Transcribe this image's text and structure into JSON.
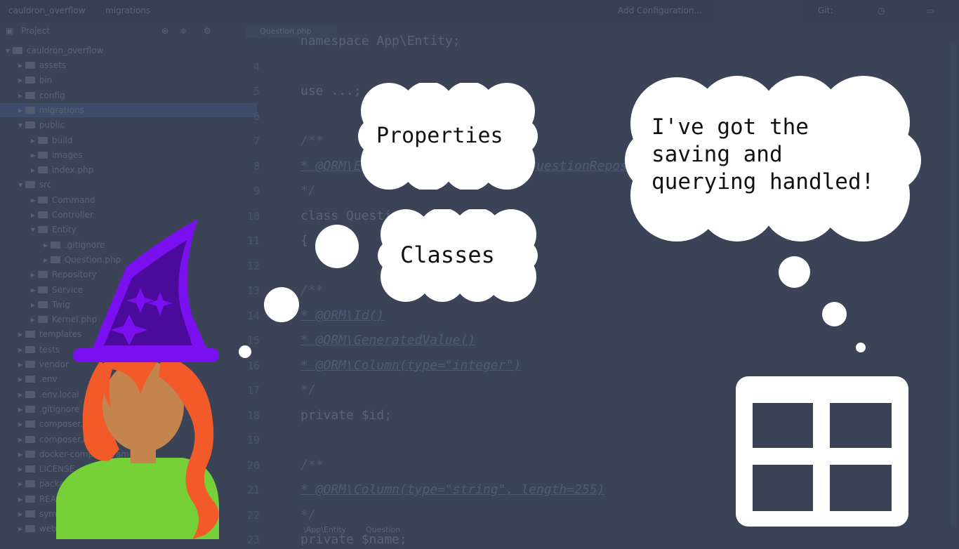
{
  "ide": {
    "window_title": "cauldron_overflow",
    "breadcrumb": "migrations",
    "run_config": "Add Configuration...",
    "git_label": "Git:",
    "project_panel": {
      "title": "Project",
      "root": "cauldron_overflow"
    },
    "tree": [
      {
        "label": "assets",
        "depth": 1,
        "expanded": false,
        "selected": false
      },
      {
        "label": "bin",
        "depth": 1,
        "expanded": false,
        "selected": false
      },
      {
        "label": "config",
        "depth": 1,
        "expanded": false,
        "selected": false
      },
      {
        "label": "migrations",
        "depth": 1,
        "expanded": false,
        "selected": true
      },
      {
        "label": "public",
        "depth": 1,
        "expanded": true,
        "selected": false
      },
      {
        "label": "build",
        "depth": 2,
        "expanded": false,
        "selected": false
      },
      {
        "label": "images",
        "depth": 2,
        "expanded": false,
        "selected": false
      },
      {
        "label": "index.php",
        "depth": 2,
        "expanded": false,
        "selected": false
      },
      {
        "label": "src",
        "depth": 1,
        "expanded": true,
        "selected": false
      },
      {
        "label": "Command",
        "depth": 2,
        "expanded": false,
        "selected": false
      },
      {
        "label": "Controller",
        "depth": 2,
        "expanded": false,
        "selected": false
      },
      {
        "label": "Entity",
        "depth": 2,
        "expanded": true,
        "selected": false
      },
      {
        "label": ".gitignore",
        "depth": 3,
        "expanded": false,
        "selected": false
      },
      {
        "label": "Question.php",
        "depth": 3,
        "expanded": false,
        "selected": false
      },
      {
        "label": "Repository",
        "depth": 2,
        "expanded": false,
        "selected": false
      },
      {
        "label": "Service",
        "depth": 2,
        "expanded": false,
        "selected": false
      },
      {
        "label": "Twig",
        "depth": 2,
        "expanded": false,
        "selected": false
      },
      {
        "label": "Kernel.php",
        "depth": 2,
        "expanded": false,
        "selected": false
      },
      {
        "label": "templates",
        "depth": 1,
        "expanded": false,
        "selected": false
      },
      {
        "label": "tests",
        "depth": 1,
        "expanded": false,
        "selected": false
      },
      {
        "label": "vendor",
        "depth": 1,
        "expanded": false,
        "selected": false
      },
      {
        "label": ".env",
        "depth": 1,
        "expanded": false,
        "selected": false
      },
      {
        "label": ".env.local",
        "depth": 1,
        "expanded": false,
        "selected": false
      },
      {
        "label": ".gitignore",
        "depth": 1,
        "expanded": false,
        "selected": false
      },
      {
        "label": "composer.json",
        "depth": 1,
        "expanded": false,
        "selected": false
      },
      {
        "label": "composer.lock",
        "depth": 1,
        "expanded": false,
        "selected": false
      },
      {
        "label": "docker-compose.yaml",
        "depth": 1,
        "expanded": false,
        "selected": false
      },
      {
        "label": "LICENSE",
        "depth": 1,
        "expanded": false,
        "selected": false
      },
      {
        "label": "package.json",
        "depth": 1,
        "expanded": false,
        "selected": false
      },
      {
        "label": "README.md",
        "depth": 1,
        "expanded": false,
        "selected": false
      },
      {
        "label": "symfony.lock",
        "depth": 1,
        "expanded": false,
        "selected": false
      },
      {
        "label": "webpack.config.js",
        "depth": 1,
        "expanded": false,
        "selected": false
      }
    ],
    "editor_tab": "Question.php",
    "code_lines": [
      {
        "ln": "",
        "text": "namespace App\\Entity;",
        "kind": "code"
      },
      {
        "ln": "4",
        "text": "",
        "kind": "code"
      },
      {
        "ln": "5",
        "text": "use ...;",
        "kind": "code"
      },
      {
        "ln": "6",
        "text": "",
        "kind": "code"
      },
      {
        "ln": "7",
        "text": "/**",
        "kind": "comment"
      },
      {
        "ln": "8",
        "text": " * @ORM\\Entity(repositoryClass=QuestionRepository::class)",
        "kind": "annotation"
      },
      {
        "ln": "9",
        "text": " */",
        "kind": "comment"
      },
      {
        "ln": "10",
        "text": "class Question",
        "kind": "code"
      },
      {
        "ln": "11",
        "text": "{",
        "kind": "code"
      },
      {
        "ln": "12",
        "text": "",
        "kind": "code"
      },
      {
        "ln": "13",
        "text": "    /**",
        "kind": "comment"
      },
      {
        "ln": "14",
        "text": "     * @ORM\\Id()",
        "kind": "annotation"
      },
      {
        "ln": "15",
        "text": "     * @ORM\\GeneratedValue()",
        "kind": "annotation"
      },
      {
        "ln": "16",
        "text": "     * @ORM\\Column(type=\"integer\")",
        "kind": "annotation"
      },
      {
        "ln": "17",
        "text": "     */",
        "kind": "comment"
      },
      {
        "ln": "18",
        "text": "    private $id;",
        "kind": "code"
      },
      {
        "ln": "19",
        "text": "",
        "kind": "code"
      },
      {
        "ln": "20",
        "text": "    /**",
        "kind": "comment"
      },
      {
        "ln": "21",
        "text": "     * @ORM\\Column(type=\"string\", length=255)",
        "kind": "annotation"
      },
      {
        "ln": "22",
        "text": "     */",
        "kind": "comment"
      },
      {
        "ln": "23",
        "text": "    private $name;",
        "kind": "code"
      }
    ],
    "bottom_breadcrumbs": [
      "\\App\\Entity",
      "Question"
    ]
  },
  "overlay": {
    "cloud_properties": "Properties",
    "cloud_classes": "Classes",
    "cloud_speech": [
      "I've got the",
      "saving and",
      "querying handled!"
    ]
  },
  "colors": {
    "background": "#3a4456",
    "cloud": "#ffffff",
    "hat_outer": "#7a10f0",
    "hat_inner": "#4a0a9a",
    "hair": "#f25a2a",
    "skin": "#c4844e",
    "shirt": "#76d038"
  }
}
